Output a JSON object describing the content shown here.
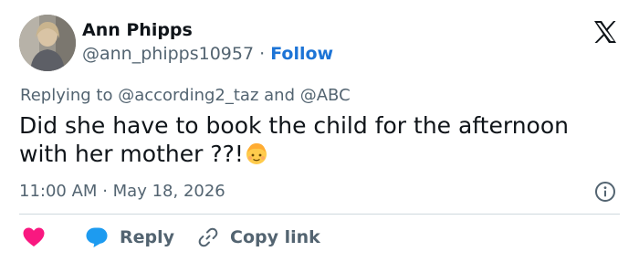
{
  "user": {
    "name": "Ann Phipps",
    "handle": "@ann_phipps10957",
    "separator": "·",
    "follow_label": "Follow"
  },
  "reply": {
    "prefix": "Replying to",
    "mention1": "@according2_taz",
    "conjunction": "and",
    "mention2": "@ABC"
  },
  "tweet": {
    "text_line1": "Did she have to book the child for the afternoon",
    "text_line2": "with her mother ??!",
    "emoji": "child-face-emoji"
  },
  "meta": {
    "time": "11:00 AM",
    "separator": "·",
    "date": "May 18, 2026"
  },
  "actions": {
    "like_icon": "heart-icon",
    "reply_label": "Reply",
    "copy_label": "Copy link"
  },
  "colors": {
    "heart": "#f91880",
    "reply_bubble": "#1d9bf0",
    "follow": "#1d74d6",
    "muted": "#536471",
    "text": "#0f1419"
  }
}
